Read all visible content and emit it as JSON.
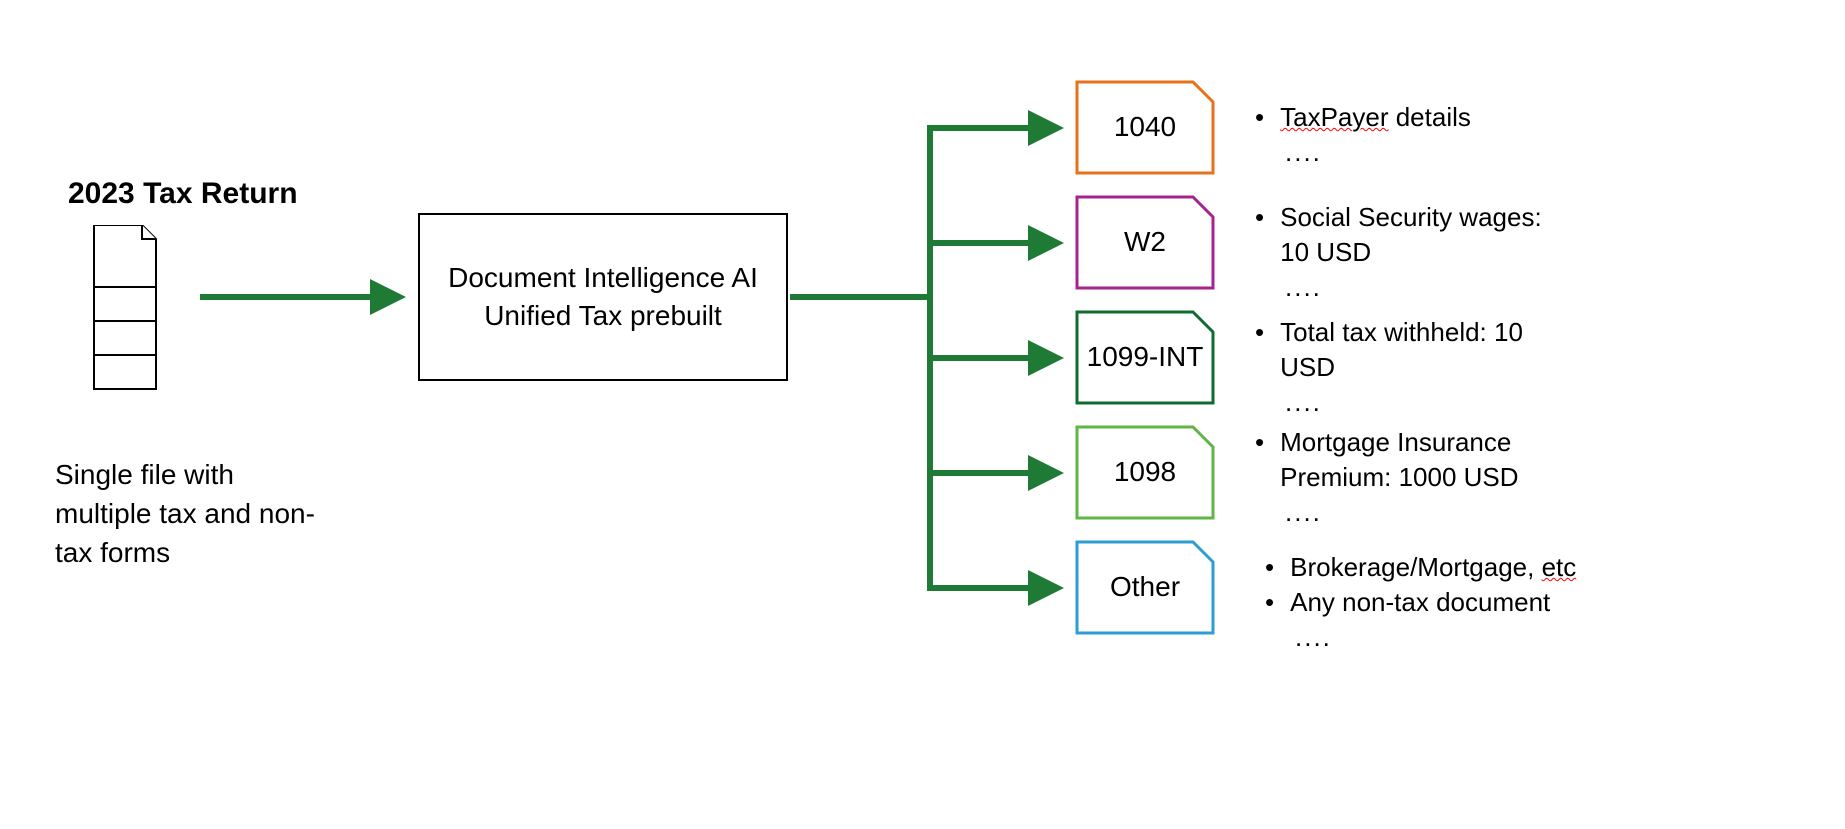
{
  "input": {
    "title": "2023 Tax Return",
    "caption": "Single file with multiple tax and non-tax forms"
  },
  "processor": {
    "line1": "Document Intelligence AI",
    "line2": "Unified Tax prebuilt"
  },
  "outputs": [
    {
      "label": "1040",
      "color": "#E8711C"
    },
    {
      "label": "W2",
      "color": "#A4238E"
    },
    {
      "label": "1099-INT",
      "color": "#0F6B2E"
    },
    {
      "label": "1098",
      "color": "#5FB547"
    },
    {
      "label": "Other",
      "color": "#2E9DD6"
    }
  ],
  "details": {
    "d0": {
      "item1_a": "TaxPayer",
      "item1_b": " details",
      "ellipsis": "...."
    },
    "d1": {
      "item1": "Social Security wages: 10 USD",
      "ellipsis": "...."
    },
    "d2": {
      "item1": "Total tax withheld: 10 USD",
      "ellipsis": "...."
    },
    "d3": {
      "item1": "Mortgage Insurance Premium: 1000 USD",
      "ellipsis": "...."
    },
    "d4": {
      "item1_a": "Brokerage/Mortgage, ",
      "item1_b": "etc",
      "item2": "Any non-tax document",
      "ellipsis": "...."
    }
  },
  "colors": {
    "arrow": "#1F7A35"
  }
}
